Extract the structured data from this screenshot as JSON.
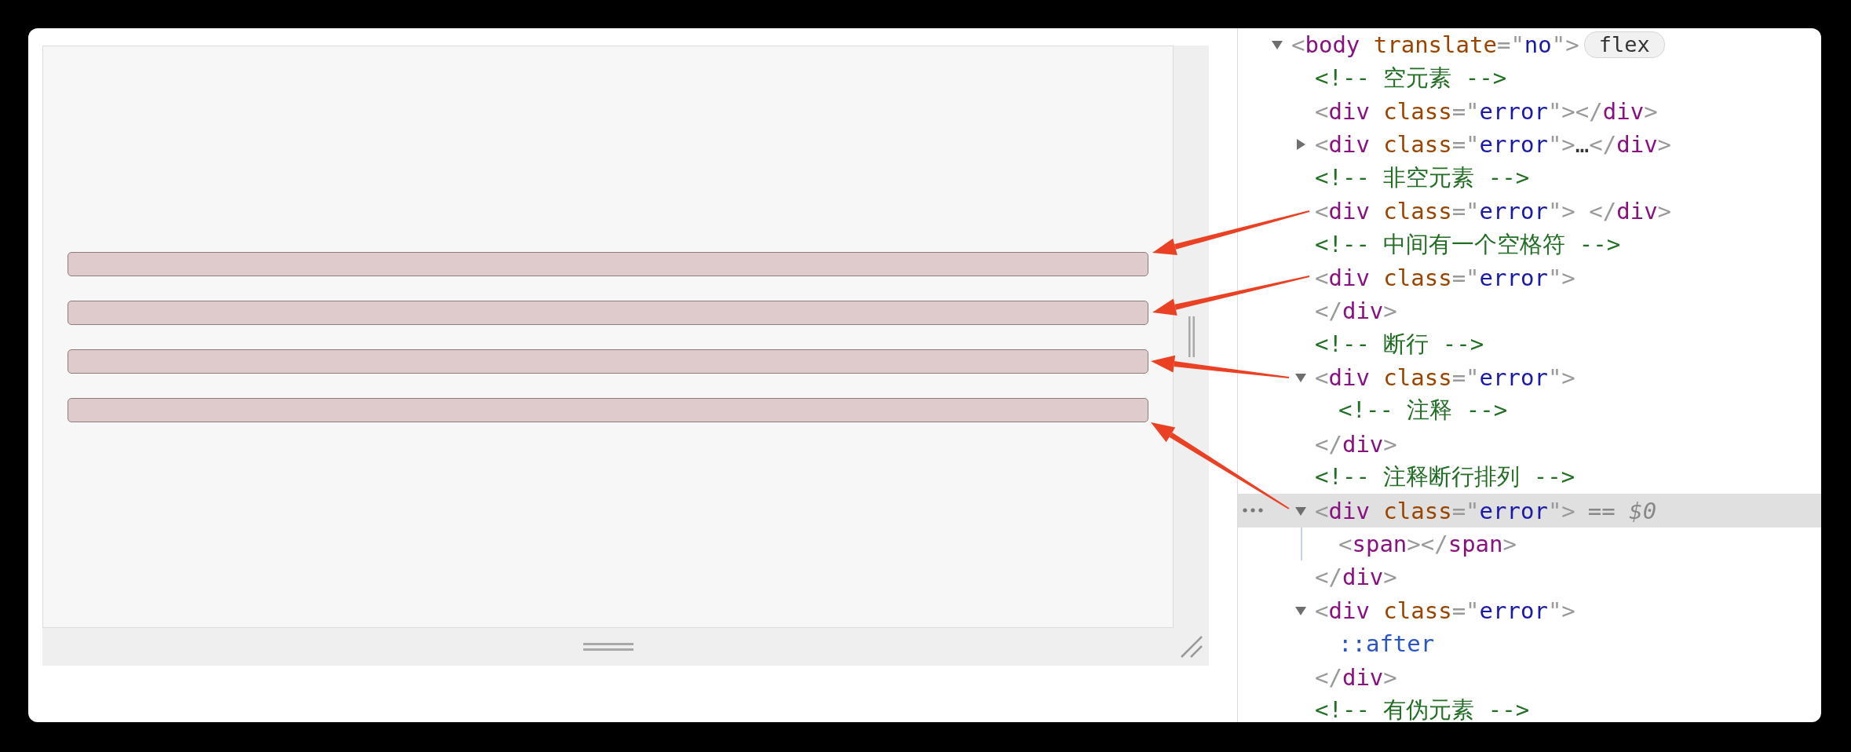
{
  "tree": [
    {
      "kind": "element",
      "open": "<body translate=\"no\">",
      "badge": "flex",
      "expanded": true,
      "selected": false,
      "children": [
        {
          "kind": "comment",
          "text": "<!-- 空元素 -->",
          "selected": false
        },
        {
          "kind": "element",
          "open": "<div class=\"error\"></div>",
          "selected": false
        },
        {
          "kind": "element",
          "open": "<div class=\"error\">…</div>",
          "expanded": false,
          "selected": false
        },
        {
          "kind": "comment",
          "text": "<!-- 非空元素 -->",
          "selected": false
        },
        {
          "kind": "element",
          "open": "<div class=\"error\"> </div>",
          "selected": false
        },
        {
          "kind": "comment",
          "text": "<!-- 中间有一个空格符 -->",
          "selected": false
        },
        {
          "kind": "element",
          "open": "<div class=\"error\">",
          "close": "</div>",
          "selected": false
        },
        {
          "kind": "comment",
          "text": "<!-- 断行 -->",
          "selected": false
        },
        {
          "kind": "element",
          "open": "<div class=\"error\">",
          "expanded": true,
          "selected": false,
          "children": [
            {
              "kind": "comment",
              "text": "<!-- 注释 -->",
              "selected": false
            }
          ],
          "close": "</div>"
        },
        {
          "kind": "comment",
          "text": "<!-- 注释断行排列 -->",
          "selected": false
        },
        {
          "kind": "element",
          "open": "<div class=\"error\">",
          "expanded": true,
          "selected": true,
          "suffix": "== $0",
          "children": [
            {
              "kind": "element",
              "open": "<span></span>",
              "selected": false
            }
          ],
          "close": "</div>"
        },
        {
          "kind": "element",
          "open": "<div class=\"error\">",
          "expanded": true,
          "selected": false,
          "children": [
            {
              "kind": "pseudo",
              "text": "::after",
              "selected": false
            }
          ],
          "close": "</div>"
        },
        {
          "kind": "comment",
          "text": "<!-- 有伪元素 -->",
          "selected": false
        }
      ]
    }
  ]
}
